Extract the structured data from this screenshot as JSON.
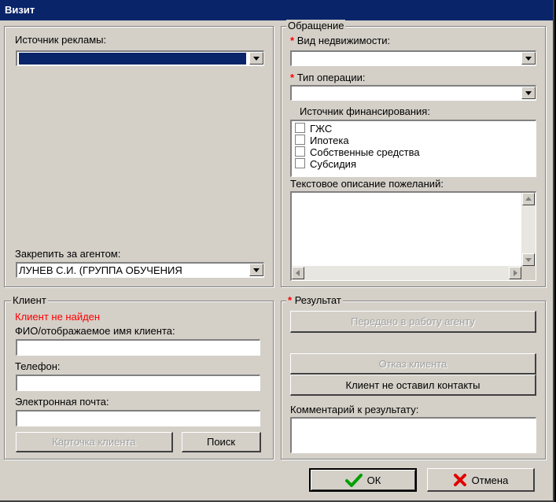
{
  "window": {
    "title": "Визит"
  },
  "left_panel": {
    "ad_source_label": "Источник рекламы:",
    "ad_source_value": "",
    "agent_label": "Закрепить за агентом:",
    "agent_value": "ЛУНЕВ С.И. (ГРУППА ОБУЧЕНИЯ"
  },
  "request": {
    "legend": "Обращение",
    "property_type_label": "Вид недвижимости:",
    "property_type_value": "",
    "operation_type_label": "Тип операции:",
    "operation_type_value": "",
    "financing_label": "Источник финансирования:",
    "financing_options": [
      "ГЖС",
      "Ипотека",
      "Собственные средства",
      "Субсидия"
    ],
    "description_label": "Текстовое описание пожеланий:",
    "required_mark": "*"
  },
  "client": {
    "legend": "Клиент",
    "status": "Клиент не найден",
    "status_color": "#ff0000",
    "name_label": "ФИО/отображаемое имя клиента:",
    "name_value": "",
    "phone_label": "Телефон:",
    "phone_value": "",
    "email_label": "Электронная почта:",
    "email_value": "",
    "card_button": "Карточка клиента",
    "search_button": "Поиск"
  },
  "result": {
    "legend": "Результат",
    "required_mark": "*",
    "transfer_button": "Передано в работу агенту",
    "refusal_button": "Отказ клиента",
    "no_contacts_button": "Клиент не оставил контакты",
    "comment_label": "Комментарий к результату:"
  },
  "footer": {
    "ok_button": "ОК",
    "cancel_button": "Отмена",
    "ok_icon_color": "#00a000",
    "cancel_icon_color": "#e00000"
  }
}
